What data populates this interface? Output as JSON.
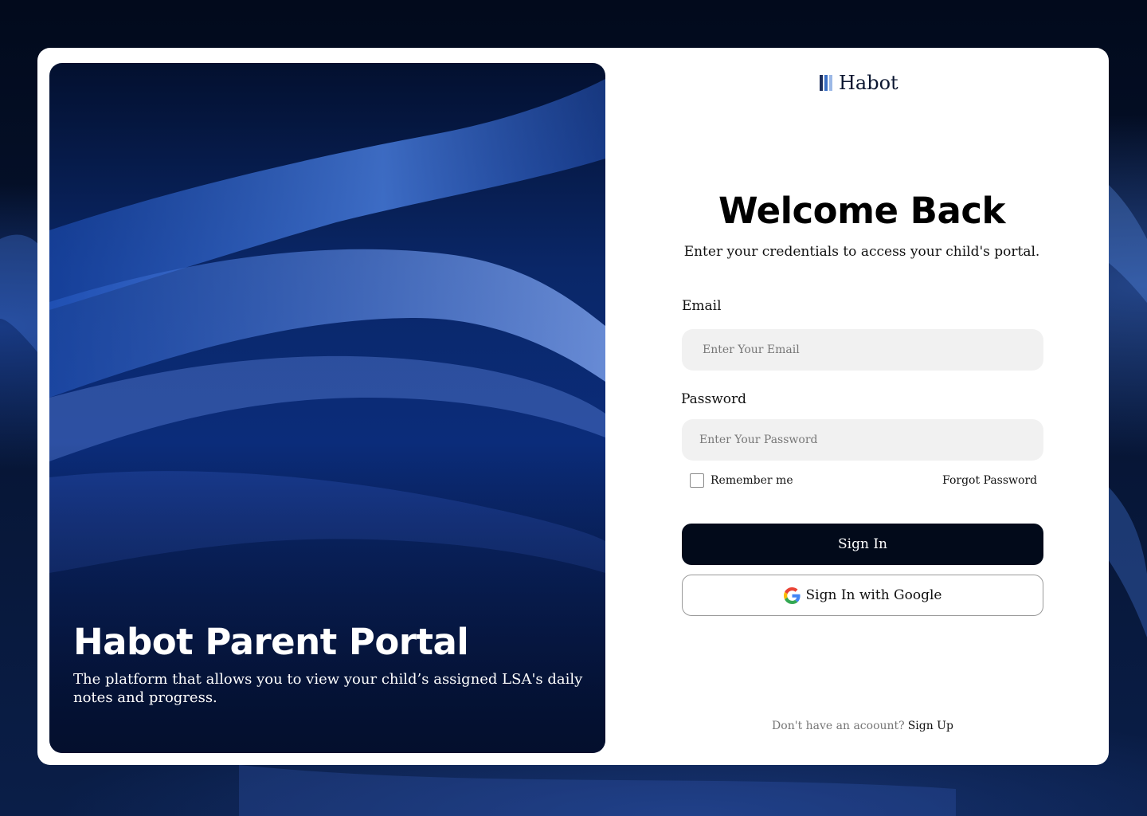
{
  "brand": {
    "name": "Habot",
    "logo_colors": [
      "#1c2d5a",
      "#3a6fc4",
      "#9cb8e6"
    ]
  },
  "hero": {
    "title": "Habot Parent Portal",
    "description": "The platform that allows you to view your child’s assigned LSA's daily notes and progress."
  },
  "form": {
    "heading": "Welcome Back",
    "subtitle": "Enter your credentials to access your child's portal.",
    "email": {
      "label": "Email",
      "placeholder": "Enter Your Email",
      "value": ""
    },
    "password": {
      "label": "Password",
      "placeholder": "Enter Your Password",
      "value": ""
    },
    "remember_label": "Remember me",
    "remember_checked": false,
    "forgot_label": "Forgot Password",
    "sign_in_label": "Sign In",
    "google_label": "Sign In with Google",
    "google_icon": "google-g-icon"
  },
  "footer": {
    "prompt": "Don't have an acoount?",
    "link": "Sign Up"
  },
  "colors": {
    "primary_button": "#020a1a",
    "input_background": "#f1f1f1",
    "hero_blue": "#0b2c7a"
  }
}
